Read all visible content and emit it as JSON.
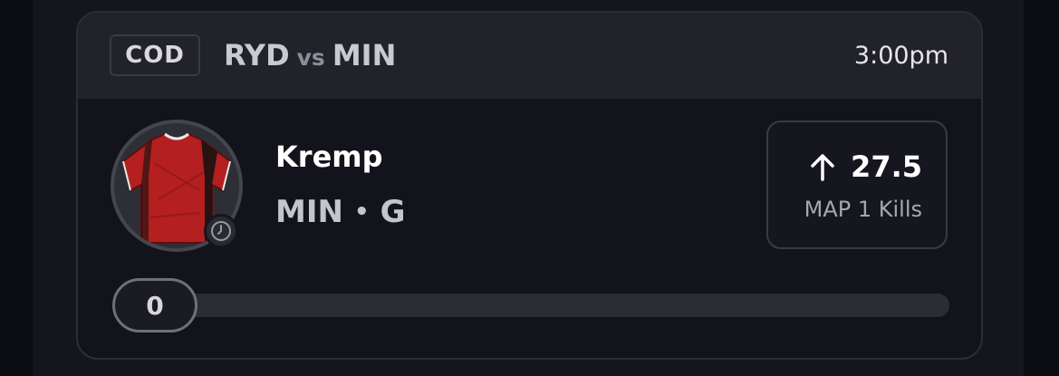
{
  "card": {
    "league": "COD",
    "team_home": "RYD",
    "vs": "vs",
    "team_away": "MIN",
    "time": "3:00pm"
  },
  "player": {
    "name": "Kremp",
    "team": "MIN",
    "separator": "•",
    "position": "G",
    "avatar_icon": "jersey-icon",
    "status_icon": "clock-icon"
  },
  "projection": {
    "direction_icon": "arrow-up-icon",
    "value": "27.5",
    "stat": "MAP 1 Kills"
  },
  "progress": {
    "current": "0",
    "fraction": 0
  },
  "colors": {
    "jersey": "#b3201f",
    "background": "#0c0c13",
    "card": "#13131b",
    "header": "#22222b"
  }
}
